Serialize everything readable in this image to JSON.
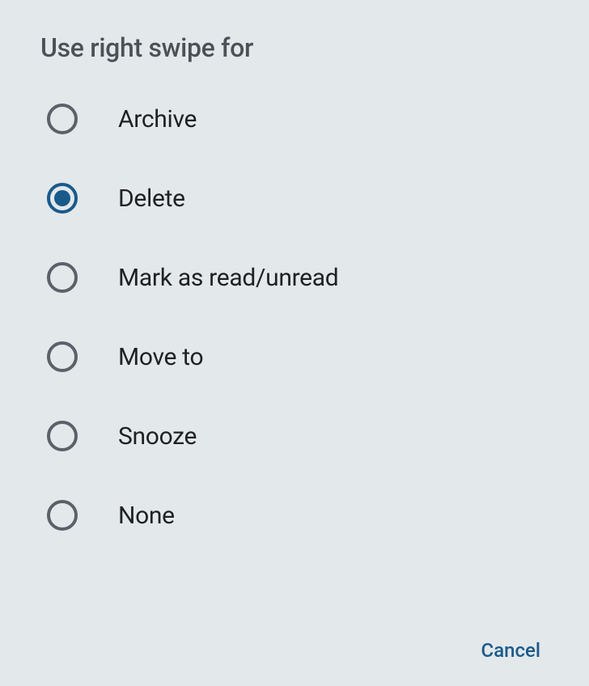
{
  "title": "Use right swipe for",
  "options": [
    {
      "id": "archive",
      "label": "Archive",
      "selected": false
    },
    {
      "id": "delete",
      "label": "Delete",
      "selected": true
    },
    {
      "id": "mark-read-unread",
      "label": "Mark as read/unread",
      "selected": false
    },
    {
      "id": "move-to",
      "label": "Move to",
      "selected": false
    },
    {
      "id": "snooze",
      "label": "Snooze",
      "selected": false
    },
    {
      "id": "none",
      "label": "None",
      "selected": false
    }
  ],
  "buttons": {
    "cancel": "Cancel"
  }
}
